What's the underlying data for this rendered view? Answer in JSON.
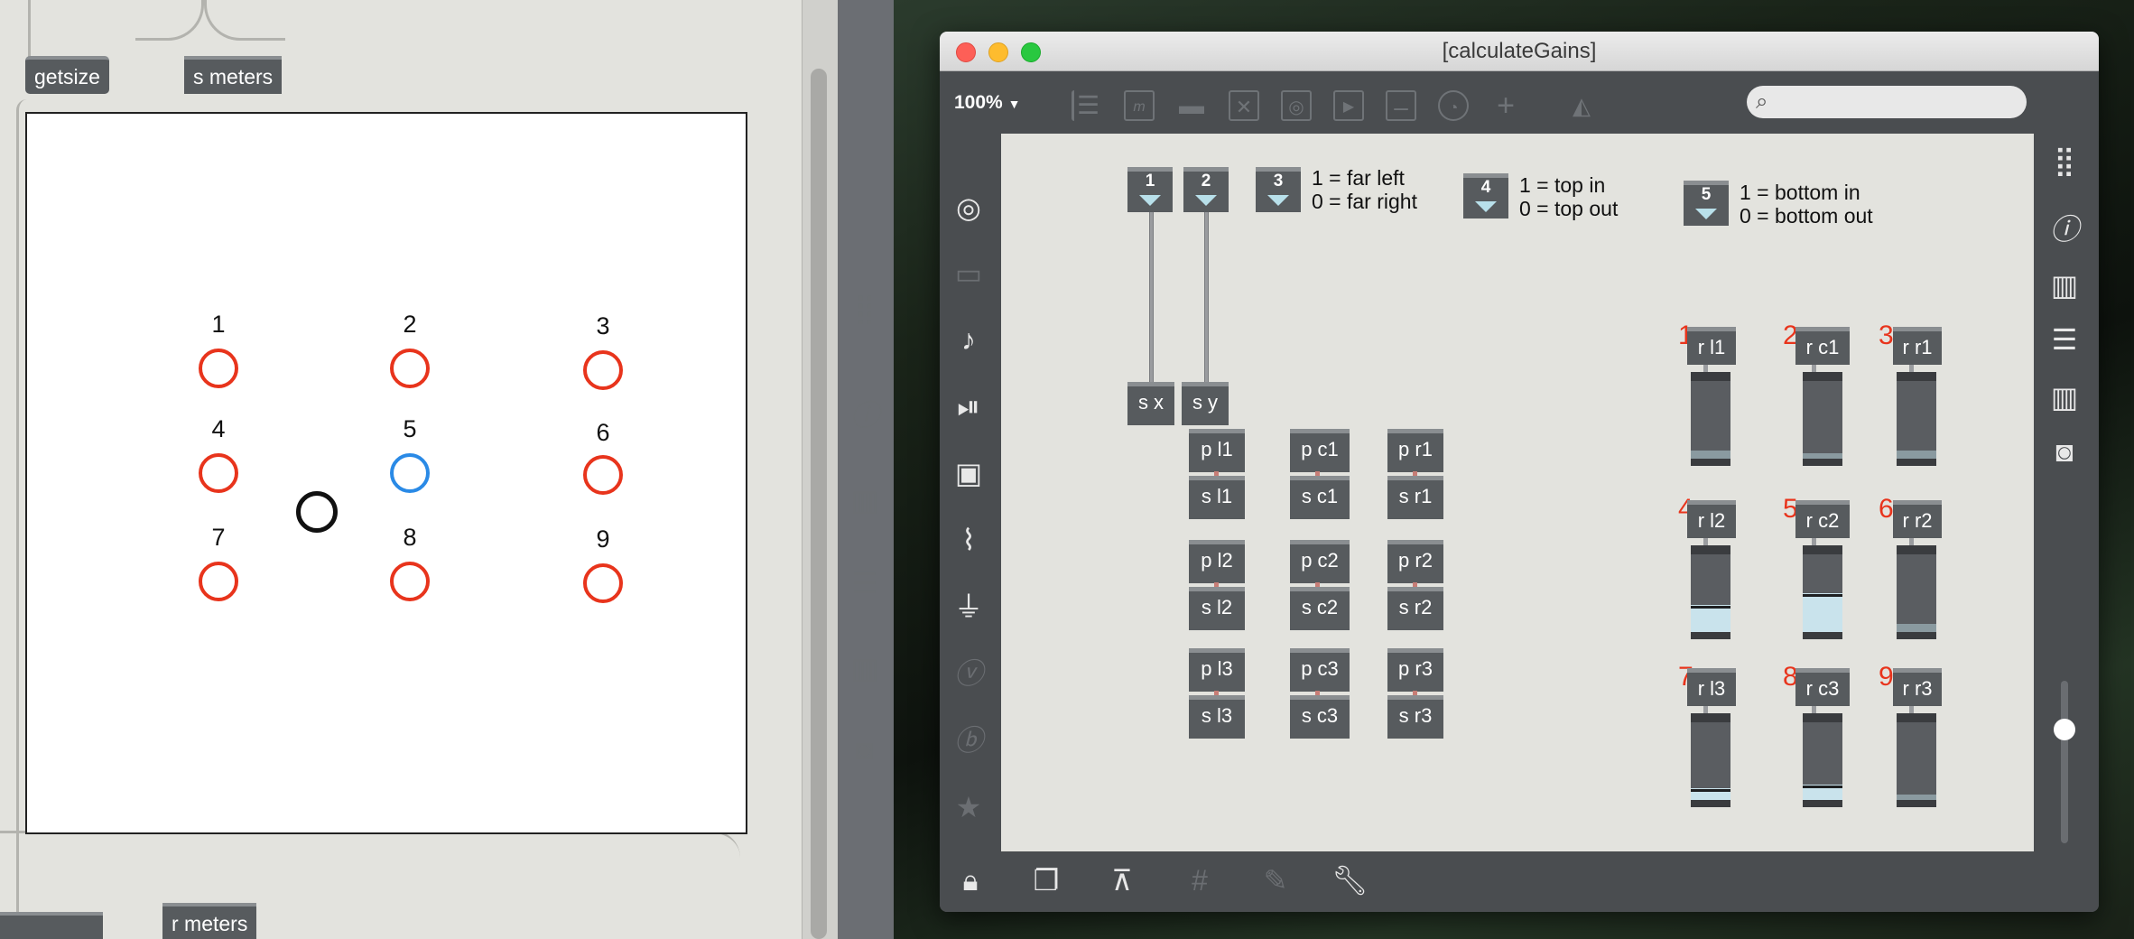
{
  "left_patcher": {
    "objects": {
      "getsize": "getsize",
      "s_meters": "s meters",
      "r_meters": "r meters"
    },
    "speakers": [
      {
        "label": "1",
        "color": "red"
      },
      {
        "label": "2",
        "color": "red"
      },
      {
        "label": "3",
        "color": "red"
      },
      {
        "label": "4",
        "color": "red"
      },
      {
        "label": "5",
        "color": "blue"
      },
      {
        "label": "6",
        "color": "red"
      },
      {
        "label": "7",
        "color": "red"
      },
      {
        "label": "8",
        "color": "red"
      },
      {
        "label": "9",
        "color": "red"
      }
    ]
  },
  "window": {
    "title": "[calculateGains]",
    "zoom": "100%",
    "zoom_arrow": "▼",
    "search_placeholder": "",
    "search_icon": "🔍"
  },
  "toolbar_icons": [
    "comment-icon",
    "message-icon",
    "speech-bubble-icon",
    "toggle-icon",
    "button-icon",
    "playlist-icon",
    "slider-icon",
    "dial-icon",
    "add-icon",
    "paint-bucket-icon"
  ],
  "numbers": [
    {
      "v": "1"
    },
    {
      "v": "2"
    },
    {
      "v": "3"
    },
    {
      "v": "4"
    },
    {
      "v": "5"
    }
  ],
  "comments": {
    "c3": "1 = far left\n0 = far right",
    "c4": "1 = top in\n0 = top out",
    "c5": "1 = bottom in\n0 = bottom out"
  },
  "send_xy": {
    "sx": "s x",
    "sy": "s y"
  },
  "pairs": [
    {
      "p": "p l1",
      "s": "s l1"
    },
    {
      "p": "p c1",
      "s": "s c1"
    },
    {
      "p": "p r1",
      "s": "s r1"
    },
    {
      "p": "p l2",
      "s": "s l2"
    },
    {
      "p": "p c2",
      "s": "s c2"
    },
    {
      "p": "p r2",
      "s": "s r2"
    },
    {
      "p": "p l3",
      "s": "s l3"
    },
    {
      "p": "p c3",
      "s": "s c3"
    },
    {
      "p": "p r3",
      "s": "s r3"
    }
  ],
  "meters": [
    {
      "n": "1",
      "r": "r l1",
      "level": 0.1
    },
    {
      "n": "2",
      "r": "r c1",
      "level": 0.0
    },
    {
      "n": "3",
      "r": "r r1",
      "level": 0.1
    },
    {
      "n": "4",
      "r": "r l2",
      "level": 0.35
    },
    {
      "n": "5",
      "r": "r c2",
      "level": 0.5
    },
    {
      "n": "6",
      "r": "r r2",
      "level": 0.1
    },
    {
      "n": "7",
      "r": "r l3",
      "level": 0.15
    },
    {
      "n": "8",
      "r": "r c3",
      "level": 0.2
    },
    {
      "n": "9",
      "r": "r r3",
      "level": 0.05
    }
  ],
  "sidebar_left_icons": [
    "target-icon",
    "device-icon",
    "music-note-icon",
    "media-icon",
    "image-icon",
    "paperclip-icon",
    "plug-icon",
    "v-icon",
    "b-icon",
    "star-icon"
  ],
  "sidebar_right_icons": [
    "grid-icon",
    "info-icon",
    "book-icon",
    "list-icon",
    "open-book-icon",
    "camera-icon",
    "mixer-slider-icon",
    "power-icon"
  ],
  "bottom_icons": [
    "lock-icon",
    "presentation-icon",
    "projector-icon",
    "grid-icon",
    "pencil-add-icon",
    "wrench-icon"
  ],
  "colors": {
    "speaker_red": "#e8341c",
    "speaker_blue": "#2a8ae6",
    "canvas": "#e3e3de",
    "object": "#575b5e",
    "meter_fill": "#c9e3ec"
  }
}
